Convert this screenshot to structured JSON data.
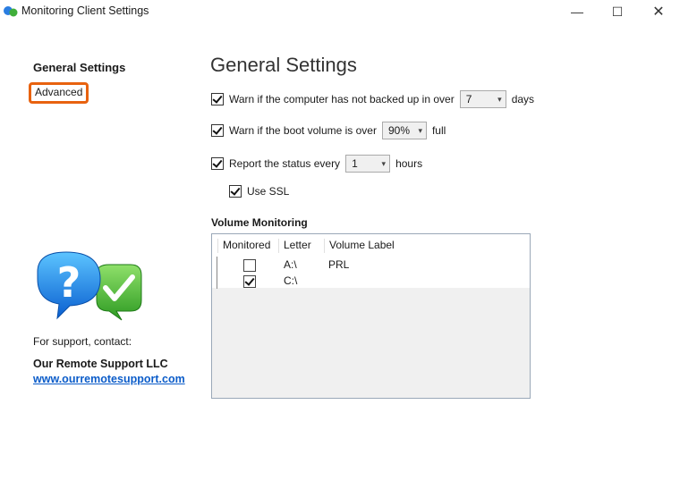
{
  "window": {
    "title": "Monitoring Client Settings",
    "controls": {
      "minimize": "—",
      "maximize": "☐",
      "close": "✕"
    }
  },
  "nav": {
    "items": [
      {
        "label": "General Settings",
        "selected": true
      },
      {
        "label": "Advanced",
        "highlighted": true
      }
    ]
  },
  "support": {
    "contact_label": "For support, contact:",
    "company": "Our Remote Support LLC",
    "link": "www.ourremotesupport.com"
  },
  "page": {
    "title": "General Settings"
  },
  "settings": {
    "backup_warning": {
      "checked": true,
      "label": "Warn if the computer has not backed up in over",
      "value": "7",
      "unit": "days"
    },
    "boot_volume": {
      "checked": true,
      "label": "Warn if the boot volume is over",
      "value": "90%",
      "unit": "full"
    },
    "status_report": {
      "checked": true,
      "label": "Report the status every",
      "value": "1",
      "unit": "hours"
    },
    "use_ssl": {
      "checked": true,
      "label": "Use SSL"
    }
  },
  "volume_monitoring": {
    "title": "Volume Monitoring",
    "columns": [
      "Monitored",
      "Letter",
      "Volume Label"
    ],
    "rows": [
      {
        "monitored": false,
        "letter": "A:\\",
        "label": "PRL"
      },
      {
        "monitored": true,
        "letter": "C:\\",
        "label": ""
      }
    ]
  },
  "colors": {
    "accent_outline": "#e8620f",
    "link": "#0b5cc9",
    "table_border": "#9aa8b8"
  }
}
